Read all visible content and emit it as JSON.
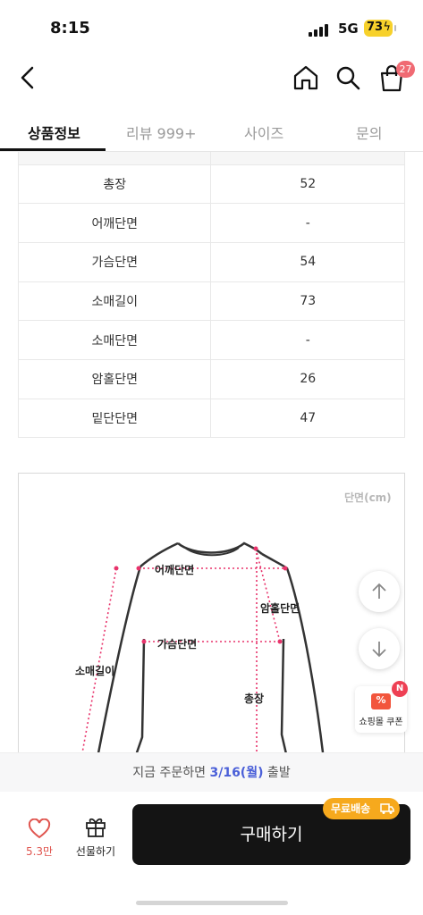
{
  "status_bar": {
    "time": "8:15",
    "network": "5G",
    "battery": "73"
  },
  "header": {
    "cart_count": "27"
  },
  "tabs": [
    {
      "label": "상품정보",
      "active": true
    },
    {
      "label": "리뷰 999+"
    },
    {
      "label": "사이즈"
    },
    {
      "label": "문의"
    }
  ],
  "size_table": [
    {
      "label": "총장",
      "value": "52"
    },
    {
      "label": "어깨단면",
      "value": "-"
    },
    {
      "label": "가슴단면",
      "value": "54"
    },
    {
      "label": "소매길이",
      "value": "73"
    },
    {
      "label": "소매단면",
      "value": "-"
    },
    {
      "label": "암홀단면",
      "value": "26"
    },
    {
      "label": "밑단단면",
      "value": "47"
    }
  ],
  "diagram": {
    "unit": "단면(cm)",
    "labels": {
      "shoulder": "어깨단면",
      "armhole": "암홀단면",
      "chest": "가슴단면",
      "sleeve": "소매길이",
      "length": "총장"
    }
  },
  "floating": {
    "coupon_new": "N",
    "coupon_label": "쇼핑몰 쿠폰"
  },
  "delivery": {
    "prefix": "지금 주문하면 ",
    "date": "3/16(월)",
    "suffix": " 출발"
  },
  "bottom_bar": {
    "like_count": "5.3만",
    "gift_label": "선물하기",
    "buy_label": "구매하기",
    "free_shipping": "무료배송"
  },
  "colors": {
    "accent_red": "#e0554f",
    "delivery_date": "#4a5fd8",
    "free_ship": "#f6a91d",
    "measure_line": "#e8336b"
  }
}
